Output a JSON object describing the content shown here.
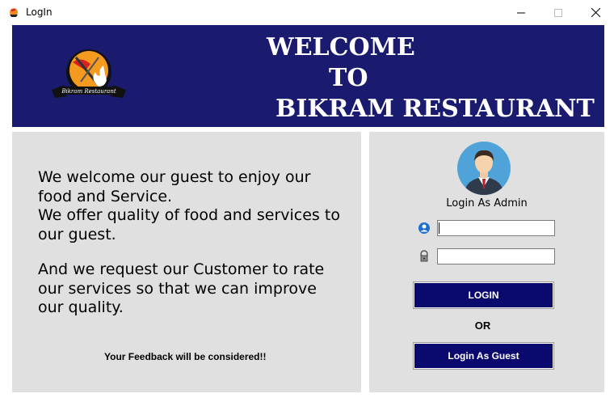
{
  "window": {
    "title": "LogIn",
    "icon": "restaurant-app-icon"
  },
  "header": {
    "line1": "WELCOME",
    "line2": "TO",
    "line3": "BIKRAM RESTAURANT",
    "logo_text": "Bikram Restaurant",
    "background": "#1a1a6f"
  },
  "info": {
    "para1": "We welcome our guest to enjoy our food and Service.\nWe offer quality of food and services to our guest.",
    "para2": "And we request our Customer to rate our services so that we can improve our quality.",
    "feedback": "Your Feedback will be considered!!"
  },
  "login": {
    "admin_label": "Login As Admin",
    "username_value": "",
    "password_value": "",
    "login_button": "LOGIN",
    "or_text": "OR",
    "guest_button": "Login As Guest",
    "button_color": "#0a0a6e"
  }
}
